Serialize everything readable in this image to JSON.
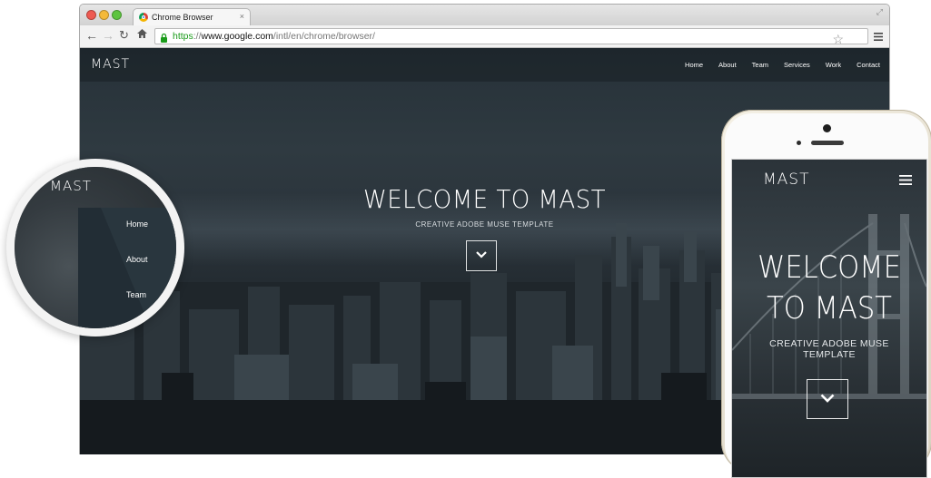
{
  "browser": {
    "tab_title": "Chrome Browser",
    "tab_close": "×",
    "url_scheme": "https",
    "url_separator": "://",
    "url_domain": "www.google.com",
    "url_path": "/intl/en/chrome/browser/",
    "icons": [
      "back-icon",
      "forward-icon",
      "reload-icon",
      "home-icon",
      "lock-icon",
      "bookmark-star-icon",
      "menu-icon",
      "fullscreen-icon"
    ]
  },
  "site": {
    "logo": "MAST",
    "nav": [
      "Home",
      "About",
      "Team",
      "Services",
      "Work",
      "Contact"
    ],
    "hero_title": "WELCOME TO MAST",
    "hero_subtitle": "CREATIVE ADOBE MUSE TEMPLATE"
  },
  "magnifier": {
    "logo": "MAST",
    "menu": [
      "Home",
      "About",
      "Team"
    ]
  },
  "phone": {
    "logo": "MAST",
    "hero_title_line1": "WELCOME",
    "hero_title_line2": "TO MAST",
    "hero_subtitle_line1": "CREATIVE ADOBE MUSE",
    "hero_subtitle_line2": "TEMPLATE"
  },
  "colors": {
    "url_https": "#1b9c1b",
    "hero_background": "#2a333a",
    "phone_body": "#e8e2d2"
  }
}
